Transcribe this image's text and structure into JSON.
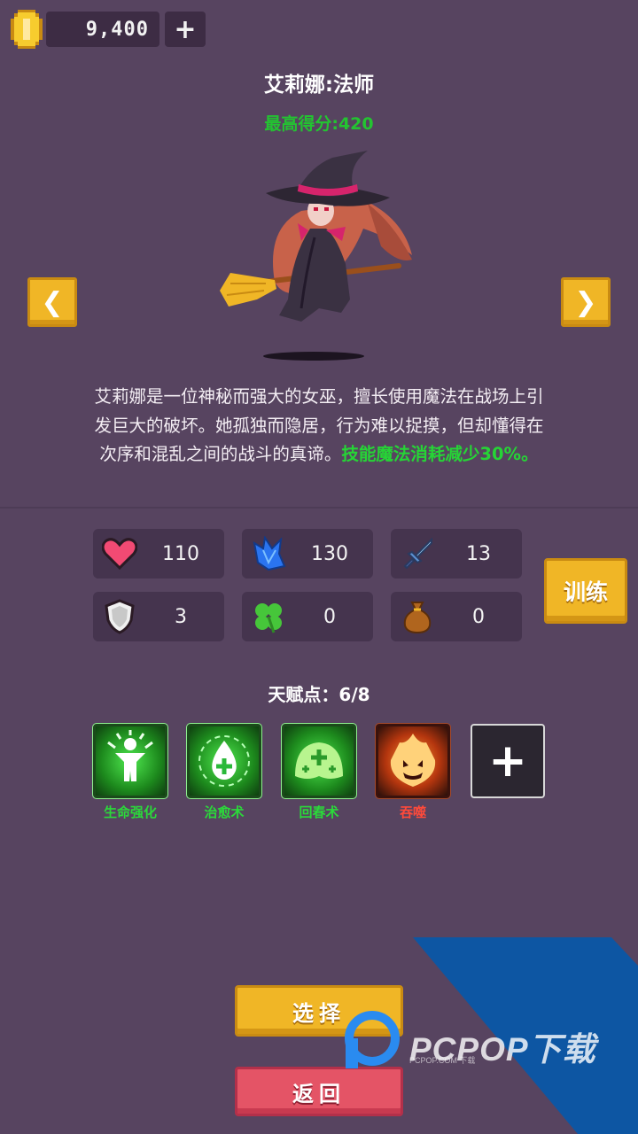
{
  "currency": {
    "amount": "9,400",
    "add_label": "+"
  },
  "hero": {
    "title": "艾莉娜:法师",
    "best_score": "最高得分:420",
    "description": "艾莉娜是一位神秘而强大的女巫，擅长使用魔法在战场上引发巨大的破坏。她孤独而隐居，行为难以捉摸，但却懂得在次序和混乱之间的战斗的真谛。",
    "description_highlight": "技能魔法消耗减少30%。"
  },
  "nav": {
    "prev_label": "❮",
    "next_label": "❯"
  },
  "stats": [
    {
      "icon": "heart-icon",
      "value": "110"
    },
    {
      "icon": "mana-crystal-icon",
      "value": "130"
    },
    {
      "icon": "sword-icon",
      "value": "13"
    },
    {
      "icon": "shield-icon",
      "value": "3"
    },
    {
      "icon": "clover-icon",
      "value": "0"
    },
    {
      "icon": "money-bag-icon",
      "value": "0"
    }
  ],
  "train_label": "训练",
  "talents": {
    "label": "天赋点：6/8",
    "skills": [
      {
        "name": "生命强化",
        "icon": "life-boost-icon",
        "color": "#2bd93a"
      },
      {
        "name": "治愈术",
        "icon": "heal-drop-icon",
        "color": "#2bd93a"
      },
      {
        "name": "回春术",
        "icon": "rejuvenation-icon",
        "color": "#2bd93a"
      },
      {
        "name": "吞噬",
        "icon": "devour-fire-icon",
        "color": "#ff4a3a"
      }
    ],
    "add_label": "+"
  },
  "buttons": {
    "select": "选择",
    "back": "返回"
  },
  "watermark": {
    "text": "PCPOP下载",
    "subtext": "PCPOP.COM 下载"
  },
  "colors": {
    "background": "#574460",
    "accent_gold": "#f0b626",
    "accent_red": "#e45466",
    "highlight_green": "#26d436"
  }
}
